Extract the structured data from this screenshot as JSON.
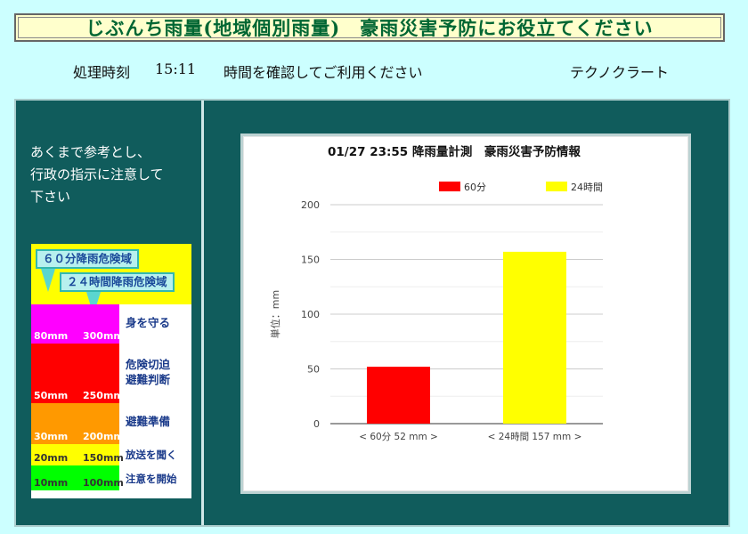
{
  "header": {
    "title": "じぶんち雨量(地域個別雨量)　豪雨災害予防にお役立てください"
  },
  "info": {
    "processing_label": "処理時刻",
    "processing_time": "15:11",
    "confirm_notice": "時間を確認してご利用ください",
    "company": "テクノクラート"
  },
  "sidebar": {
    "notice_line1": "あくまで参考とし、",
    "notice_line2": "行政の指示に注意して",
    "notice_line3": "下さい"
  },
  "legend": {
    "label_60": "６０分降雨危険域",
    "label_24": "２４時間降雨危険域",
    "bands": [
      {
        "color": "#ff00ff",
        "v60": "80mm",
        "v24": "300mm",
        "text1": "身を守る",
        "text2": ""
      },
      {
        "color": "#ff0000",
        "v60": "50mm",
        "v24": "250mm",
        "text1": "危険切迫",
        "text2": "避難判断"
      },
      {
        "color": "#ff9900",
        "v60": "30mm",
        "v24": "200mm",
        "text1": "避難準備",
        "text2": ""
      },
      {
        "color": "#ffff00",
        "v60": "20mm",
        "v24": "150mm",
        "text1": "放送を聞く",
        "text2": ""
      },
      {
        "color": "#00ff00",
        "v60": "10mm",
        "v24": "100mm",
        "text1": "注意を開始",
        "text2": ""
      }
    ]
  },
  "chart_data": {
    "type": "bar",
    "title": "01/27 23:55 降雨量計測　豪雨災害予防情報",
    "categories": [
      "< 60分 52 mm >",
      "< 24時間 157 mm >"
    ],
    "series": [
      {
        "name": "60分",
        "values": [
          52,
          null
        ],
        "color": "#ff0000"
      },
      {
        "name": "24時間",
        "values": [
          null,
          157
        ],
        "color": "#ffff00"
      }
    ],
    "ylabel": "単位：mm",
    "ylim": [
      0,
      200
    ],
    "yticks": [
      0,
      50,
      100,
      150,
      200
    ],
    "grid": true,
    "legend_position": "top"
  }
}
